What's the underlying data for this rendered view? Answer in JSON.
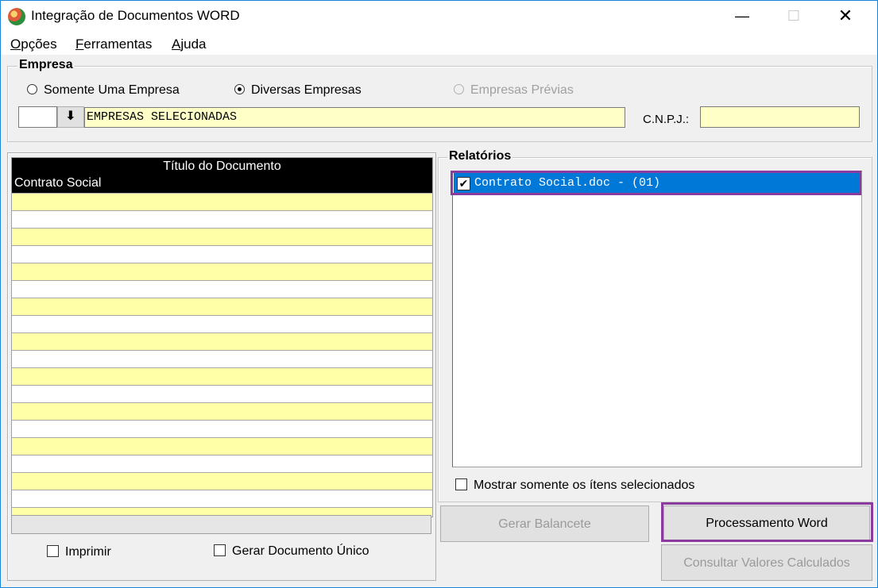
{
  "window": {
    "title": "Integração de Documentos WORD"
  },
  "menu": [
    "Opções",
    "Ferramentas",
    "Ajuda"
  ],
  "empresa": {
    "legend": "Empresa",
    "options": [
      {
        "label": "Somente Uma Empresa",
        "selected": false,
        "enabled": true
      },
      {
        "label": "Diversas Empresas",
        "selected": true,
        "enabled": true
      },
      {
        "label": "Empresas Prévias",
        "selected": false,
        "enabled": false
      }
    ],
    "code_value": "",
    "company_name": "EMPRESAS SELECIONADAS",
    "cnpj_label": "C.N.P.J.:",
    "cnpj_value": ""
  },
  "documents": {
    "header": "Título do Documento",
    "rows": [
      "Contrato Social"
    ],
    "selected_index": 0
  },
  "left_checks": [
    {
      "label": "Imprimir",
      "checked": false
    },
    {
      "label": "Gerar Documento Único",
      "checked": false
    }
  ],
  "relatorios": {
    "legend": "Relatórios",
    "items": [
      {
        "label": "Contrato Social.doc - (01)",
        "checked": true
      }
    ],
    "show_selected_label": "Mostrar somente os ítens selecionados",
    "show_selected_checked": false
  },
  "buttons": {
    "gerar_balancete": "Gerar Balancete",
    "processamento_word": "Processamento Word",
    "consultar_valores": "Consultar Valores Calculados"
  },
  "colors": {
    "highlight": "#8b3a9e",
    "selection": "#0078d7",
    "row_yellow": "#ffffa8"
  }
}
